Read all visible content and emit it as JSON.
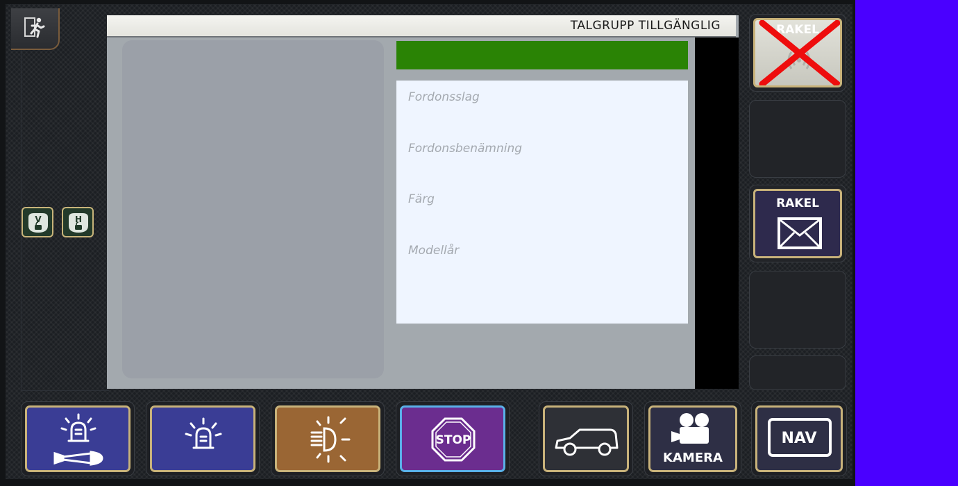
{
  "header": {
    "title": "TALGRUPP TILLGÄNGLIG"
  },
  "vehicle_info": {
    "fields": [
      {
        "label": "Fordonsslag"
      },
      {
        "label": "Fordonsbenämning"
      },
      {
        "label": "Färg"
      },
      {
        "label": "Modellår"
      }
    ]
  },
  "left_panel": {
    "exit_icon": "running-person-icon",
    "locks": [
      {
        "letter": "V",
        "icon": "lock-v-icon"
      },
      {
        "letter": "H",
        "icon": "lock-h-icon"
      }
    ]
  },
  "side_buttons": {
    "rakel_status": {
      "label": "RAKEL",
      "icon": "red-cross-icon",
      "status": "unavailable"
    },
    "rakel_message": {
      "label": "RAKEL",
      "icon": "envelope-icon"
    }
  },
  "bottom_buttons": {
    "siren": {
      "icon": "beacon-siren-icon"
    },
    "beacon": {
      "icon": "beacon-icon"
    },
    "lights": {
      "icon": "headlight-icon"
    },
    "stop": {
      "label": "STOP",
      "icon": "stop-sign-icon"
    },
    "vehicle": {
      "icon": "car-icon"
    },
    "camera": {
      "label": "KAMERA",
      "icon": "camera-icon"
    },
    "nav": {
      "label": "NAV",
      "icon": "nav-screen-icon"
    }
  },
  "colors": {
    "status_bar": "#2a8305",
    "button_blue": "#3a3d95",
    "button_brown": "#9a6634",
    "button_purple": "#6b2d8f",
    "button_border": "#c8b27a",
    "background": "#4a00ff"
  }
}
